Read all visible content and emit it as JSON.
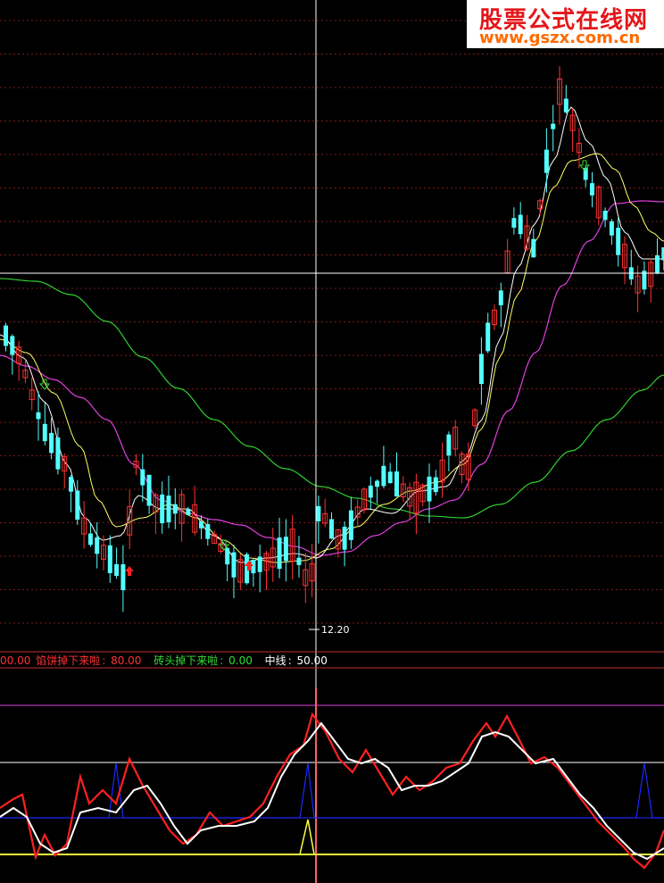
{
  "watermark": {
    "title": "股票公式在线网",
    "url": "www.gszx.com.cn"
  },
  "price_panel": {
    "low_label": "12.20"
  },
  "indicator_legend": {
    "lead_value": "00.00",
    "bottom_line": {
      "name": "馅饼掉下来啦",
      "value": "80.00"
    },
    "top_line": {
      "name": "砖头掉下来啦",
      "value": "0.00"
    },
    "mid_line": {
      "name": "中线",
      "value": "50.00"
    }
  },
  "colors": {
    "background": "#000000",
    "up_candle": "#ff3232",
    "down_candle": "#54ffff",
    "ma_short": "#ffffff",
    "ma_mid": "#ffff66",
    "ma_long": "#ff40ff",
    "ma_extra": "#33cc33",
    "watermark_title": "#e5161a",
    "watermark_url": "#ff6a00"
  }
}
